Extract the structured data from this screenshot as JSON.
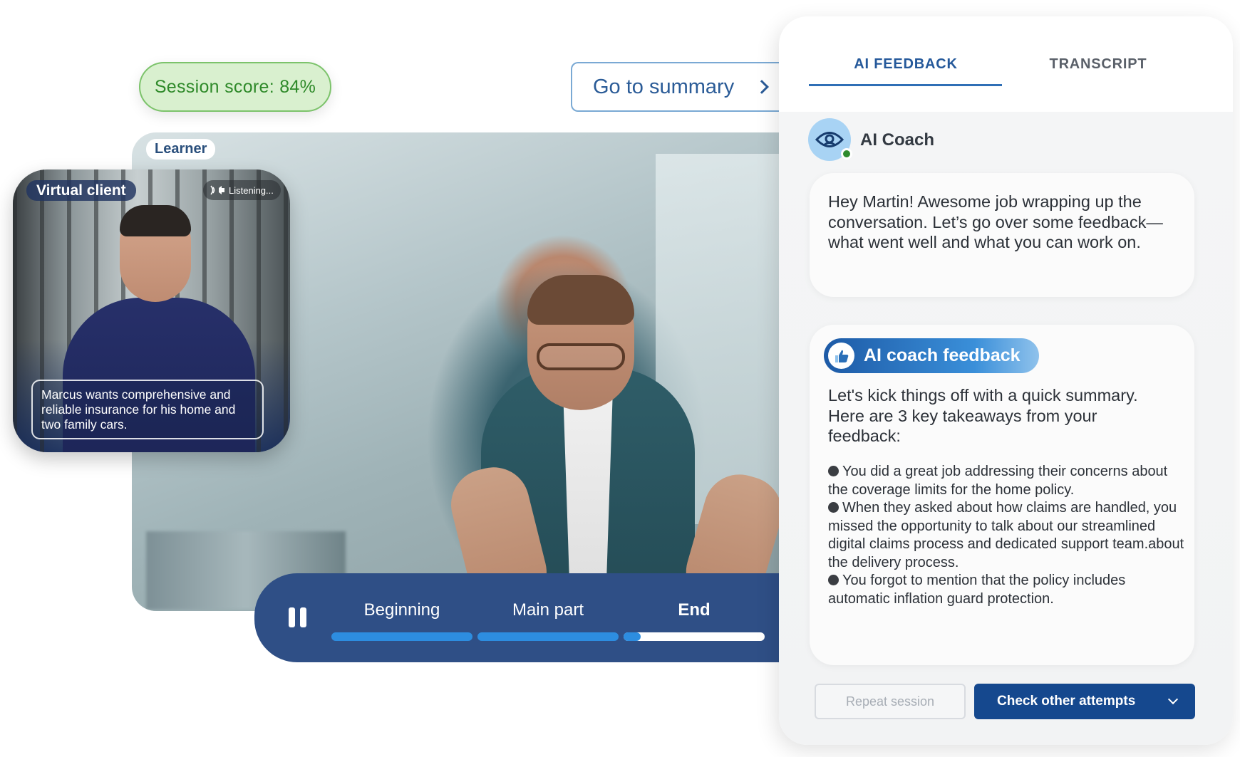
{
  "session": {
    "score_label": "Session score: 84%",
    "summary_button": "Go to summary"
  },
  "video": {
    "learner_label": "Learner"
  },
  "virtual_client": {
    "label": "Virtual client",
    "status": "Listening...",
    "caption": "Marcus wants comprehensive and reliable insurance for his home and two family cars."
  },
  "player": {
    "segments": [
      {
        "label": "Beginning",
        "progress": 1.0
      },
      {
        "label": "Main part",
        "progress": 1.0
      },
      {
        "label": "End",
        "progress": 0.12
      }
    ],
    "active_segment": "End"
  },
  "panel": {
    "tabs": [
      {
        "label": "AI FEEDBACK",
        "active": true
      },
      {
        "label": "TRANSCRIPT",
        "active": false
      }
    ],
    "coach_name": "AI Coach",
    "greeting": "Hey Martin! Awesome job wrapping up the conversation. Let’s go over some feedback—what went well and what you can work on.",
    "feedback_chip": "AI coach feedback",
    "feedback_intro": "Let's kick things off with a quick summary. Here are 3 key takeaways from your feedback:",
    "takeaways": [
      "You did a great job addressing their concerns about the coverage limits for the home policy.",
      "When they asked about how claims are handled, you missed the opportunity to talk about our streamlined digital claims process and dedicated support team.about the delivery process.",
      "You forgot to mention that the policy includes automatic inflation guard protection."
    ],
    "repeat_button": "Repeat session",
    "attempts_button": "Check other attempts"
  },
  "colors": {
    "brand_blue": "#15488e",
    "accent_blue": "#2d8de0",
    "score_green": "#2f8a2a",
    "online_green": "#2e8b2e"
  },
  "icons": {
    "coach": "eye-icon",
    "feedback": "thumbs-feedback-icon",
    "summary": "chevron-right-icon",
    "attempts": "chevron-down-icon",
    "status": "speaker-icon"
  }
}
